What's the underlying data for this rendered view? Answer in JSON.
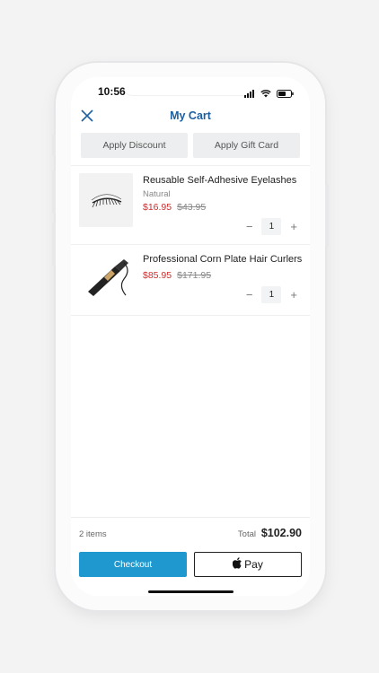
{
  "status": {
    "time": "10:56"
  },
  "header": {
    "title": "My Cart"
  },
  "actions": {
    "discount": "Apply Discount",
    "gift_card": "Apply Gift Card"
  },
  "items": [
    {
      "name": "Reusable Self-Adhesive Eyelashes",
      "variant": "Natural",
      "price": "$16.95",
      "original_price": "$43.95",
      "quantity": "1"
    },
    {
      "name": "Professional Corn Plate Hair Curlers",
      "variant": "",
      "price": "$85.95",
      "original_price": "$171.95",
      "quantity": "1"
    }
  ],
  "footer": {
    "count": "2 items",
    "total_label": "Total",
    "total_value": "$102.90",
    "checkout": "Checkout",
    "applepay": "Pay"
  },
  "colors": {
    "accent": "#1f98cf",
    "title": "#1c5fa0",
    "sale": "#d02d2d"
  },
  "icons": [
    "close-icon",
    "signal-icon",
    "wifi-icon",
    "battery-icon",
    "minus-icon",
    "plus-icon",
    "apple-icon"
  ]
}
